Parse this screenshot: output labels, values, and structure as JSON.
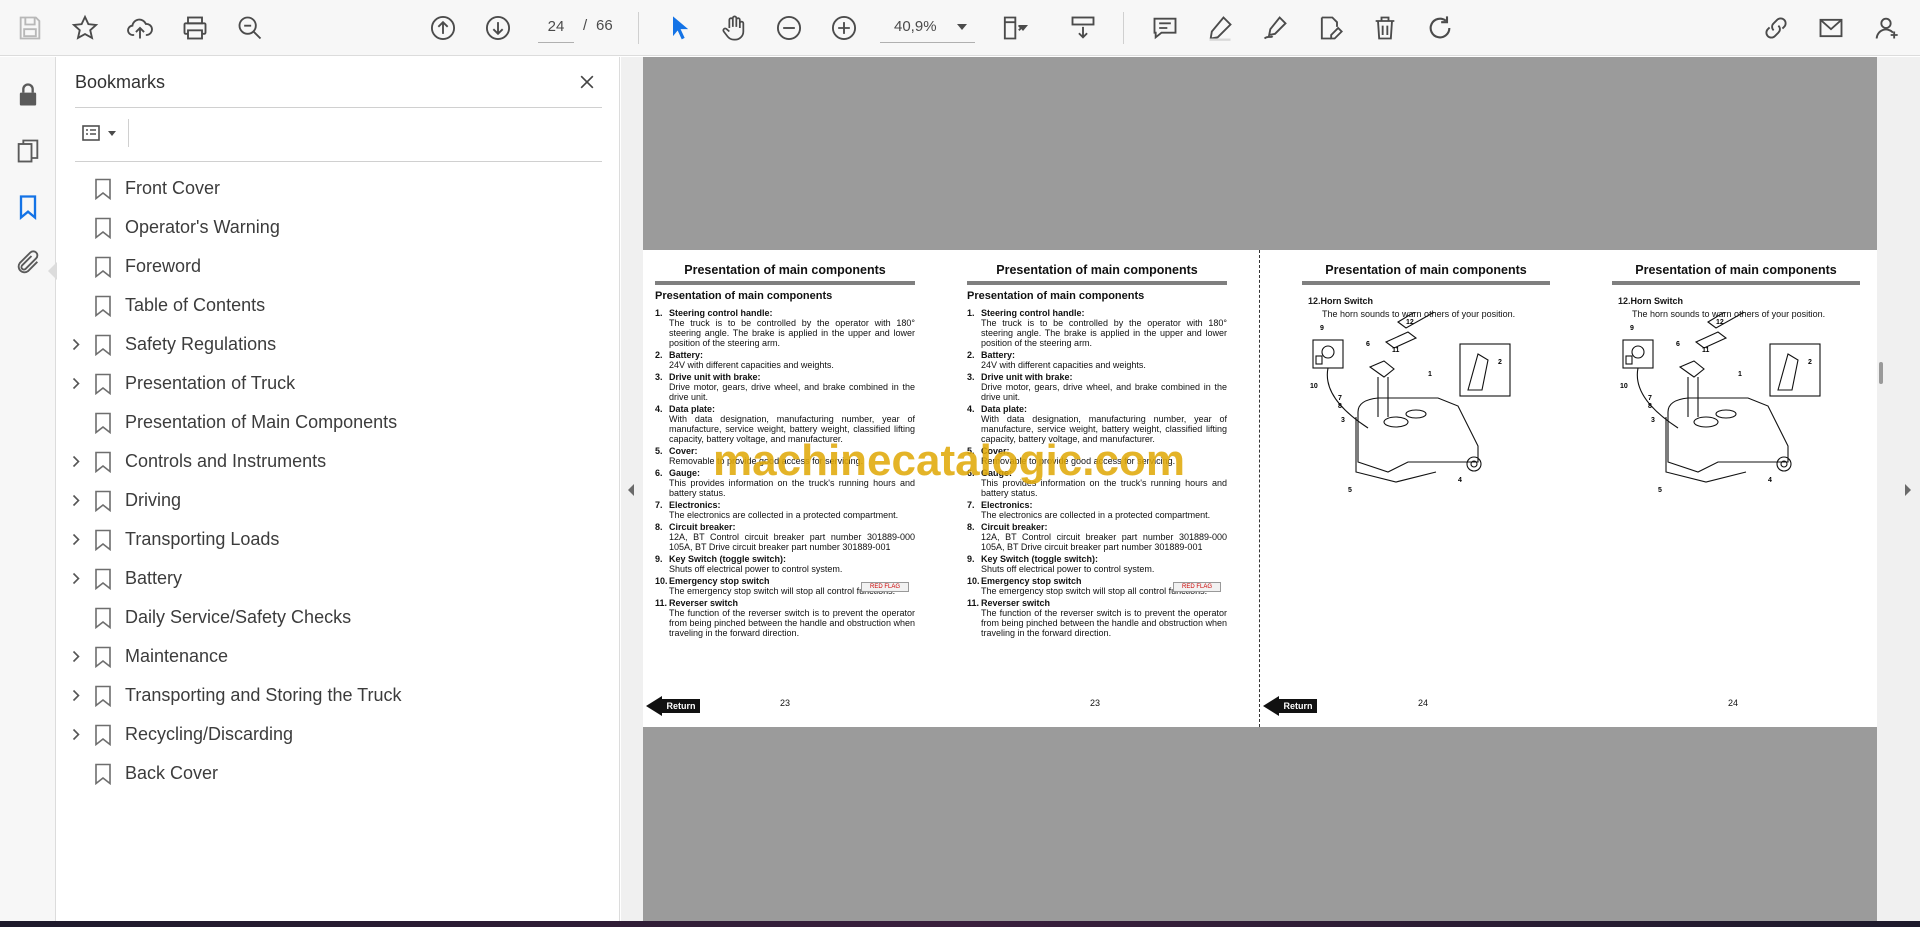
{
  "toolbar": {
    "current_page": "24",
    "page_separator": "/",
    "total_pages": "66",
    "zoom": "40,9%"
  },
  "bookmarks": {
    "title": "Bookmarks",
    "items": [
      {
        "label": "Front Cover",
        "expandable": false
      },
      {
        "label": "Operator's Warning",
        "expandable": false
      },
      {
        "label": "Foreword",
        "expandable": false
      },
      {
        "label": "Table of Contents",
        "expandable": false
      },
      {
        "label": "Safety Regulations",
        "expandable": true
      },
      {
        "label": "Presentation of Truck",
        "expandable": true
      },
      {
        "label": "Presentation of Main Components",
        "expandable": false
      },
      {
        "label": "Controls and Instruments",
        "expandable": true
      },
      {
        "label": "Driving",
        "expandable": true
      },
      {
        "label": "Transporting Loads",
        "expandable": true
      },
      {
        "label": "Battery",
        "expandable": true
      },
      {
        "label": "Daily Service/Safety Checks",
        "expandable": false
      },
      {
        "label": "Maintenance",
        "expandable": true
      },
      {
        "label": "Transporting and Storing the Truck",
        "expandable": true
      },
      {
        "label": "Recycling/Discarding",
        "expandable": true
      },
      {
        "label": "Back Cover",
        "expandable": false
      }
    ]
  },
  "document": {
    "heading": "Presentation of main components",
    "subheading": "Presentation of main components",
    "components": [
      {
        "num": "1.",
        "title": "Steering control handle:",
        "desc": "The truck is to be controlled by the operator with 180° steering angle. The brake is applied in the upper and lower position of the steering arm."
      },
      {
        "num": "2.",
        "title": "Battery:",
        "desc": "24V with different capacities and weights."
      },
      {
        "num": "3.",
        "title": "Drive unit with brake:",
        "desc": "Drive motor, gears, drive wheel, and brake combined in the drive unit."
      },
      {
        "num": "4.",
        "title": "Data plate:",
        "desc": "With data designation, manufacturing number, year of manufacture, service weight, battery weight, classified lifting capacity, battery voltage, and manufacturer."
      },
      {
        "num": "5.",
        "title": "Cover:",
        "desc": "Removable to provide good access for servicing."
      },
      {
        "num": "6.",
        "title": "Gauge:",
        "desc": "This provides information on the truck's running hours and battery status."
      },
      {
        "num": "7.",
        "title": "Electronics:",
        "desc": "The electronics are collected in a protected compartment."
      },
      {
        "num": "8.",
        "title": "Circuit breaker:",
        "desc": "12A, BT Control circuit breaker part number 301889-000 105A, BT Drive circuit breaker part number 301889-001"
      },
      {
        "num": "9.",
        "title": "Key Switch (toggle switch):",
        "desc": "Shuts off electrical power to control system."
      },
      {
        "num": "10.",
        "title": "Emergency stop switch",
        "desc": "The emergency stop switch will stop all control functions."
      },
      {
        "num": "11.",
        "title": "Reverser switch",
        "desc": "The function of the reverser switch is to prevent the operator from being pinched between the handle and obstruction when traveling in the forward direction."
      }
    ],
    "horn": {
      "num": "12.",
      "title": "Horn Switch",
      "desc": "The horn sounds to warn others of your position."
    },
    "page_left": "23",
    "page_right": "24",
    "return_label": "Return",
    "red_flag": "RED FLAG",
    "figure_callouts": [
      "1",
      "2",
      "3",
      "4",
      "5",
      "6",
      "7",
      "8",
      "9",
      "10",
      "11",
      "12"
    ],
    "watermark": "machinecatalogic.com"
  }
}
